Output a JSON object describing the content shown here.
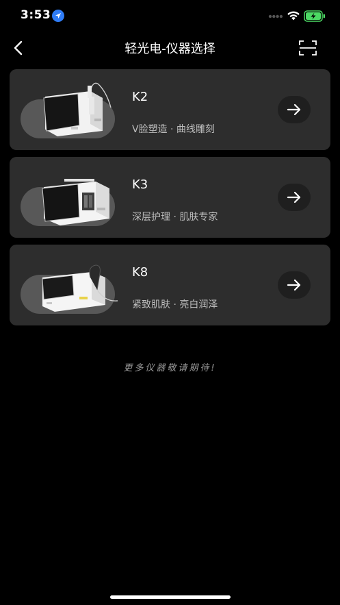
{
  "status_bar": {
    "time": "3:53",
    "battery_color": "#4cd964"
  },
  "nav": {
    "title": "轻光电-仪器选择"
  },
  "devices": [
    {
      "name": "K2",
      "description": "V脸塑造 · 曲线雕刻"
    },
    {
      "name": "K3",
      "description": "深层护理 · 肌肤专家"
    },
    {
      "name": "K8",
      "description": "紧致肌肤 · 亮白润泽"
    }
  ],
  "footer": {
    "more_text": "更多仪器敬请期待!"
  },
  "colors": {
    "background": "#000000",
    "card": "#2d2d2d",
    "blob": "#585858",
    "arrow_button": "#1f1f1f"
  }
}
